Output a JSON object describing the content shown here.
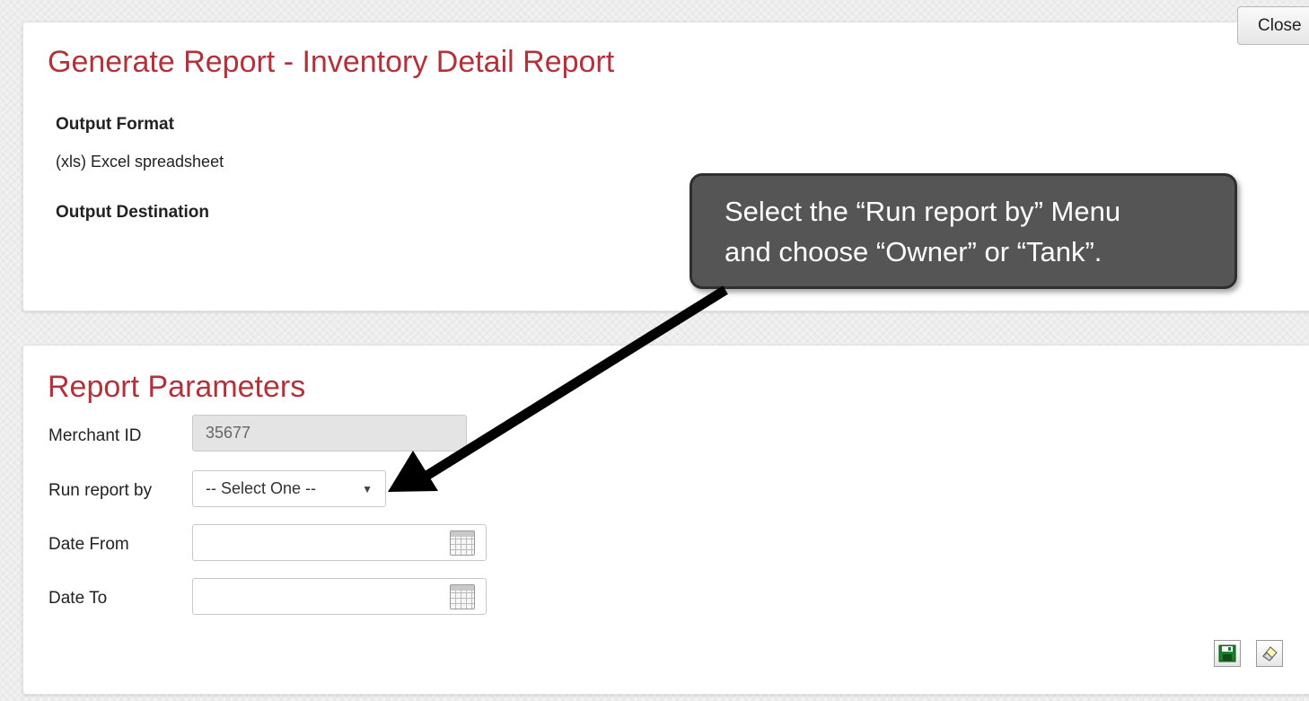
{
  "report": {
    "title": "Generate Report - Inventory Detail Report",
    "output_format_label": "Output Format",
    "output_format_value": "(xls) Excel spreadsheet",
    "output_destination_label": "Output Destination"
  },
  "close_button": "Close",
  "parameters": {
    "title": "Report Parameters",
    "merchant_id": {
      "label": "Merchant ID",
      "value": "35677"
    },
    "run_report_by": {
      "label": "Run report by",
      "selected": "-- Select One --"
    },
    "date_from": {
      "label": "Date From",
      "value": ""
    },
    "date_to": {
      "label": "Date To",
      "value": ""
    }
  },
  "actions": {
    "save_icon": "floppy-disk-icon",
    "clear_icon": "eraser-icon"
  },
  "callout": {
    "line1": "Select the “Run report by” Menu",
    "line2": "and choose “Owner” or “Tank”."
  },
  "colors": {
    "title": "#b1323a",
    "callout_bg": "#555555",
    "callout_text": "#ffffff"
  }
}
